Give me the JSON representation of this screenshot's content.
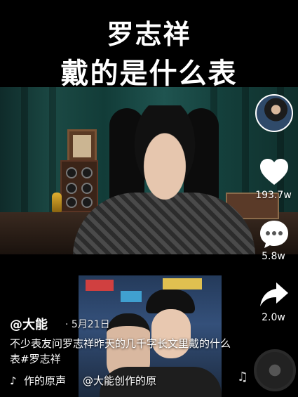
{
  "headline": {
    "line1": "罗志祥",
    "line2": "戴的是什么表"
  },
  "actions": {
    "like_count": "193.7w",
    "comment_count": "5.8w",
    "share_count": "2.0w"
  },
  "caption": {
    "author": "@大能",
    "date": "· 5月21日",
    "description": "不少表友问罗志祥昨天的几千字长文里戴的什么表#罗志祥",
    "music_part1": "作的原声",
    "music_part2": "@大能创作的原"
  },
  "colors": {
    "background": "#000000",
    "like_icon": "#ffffff"
  }
}
